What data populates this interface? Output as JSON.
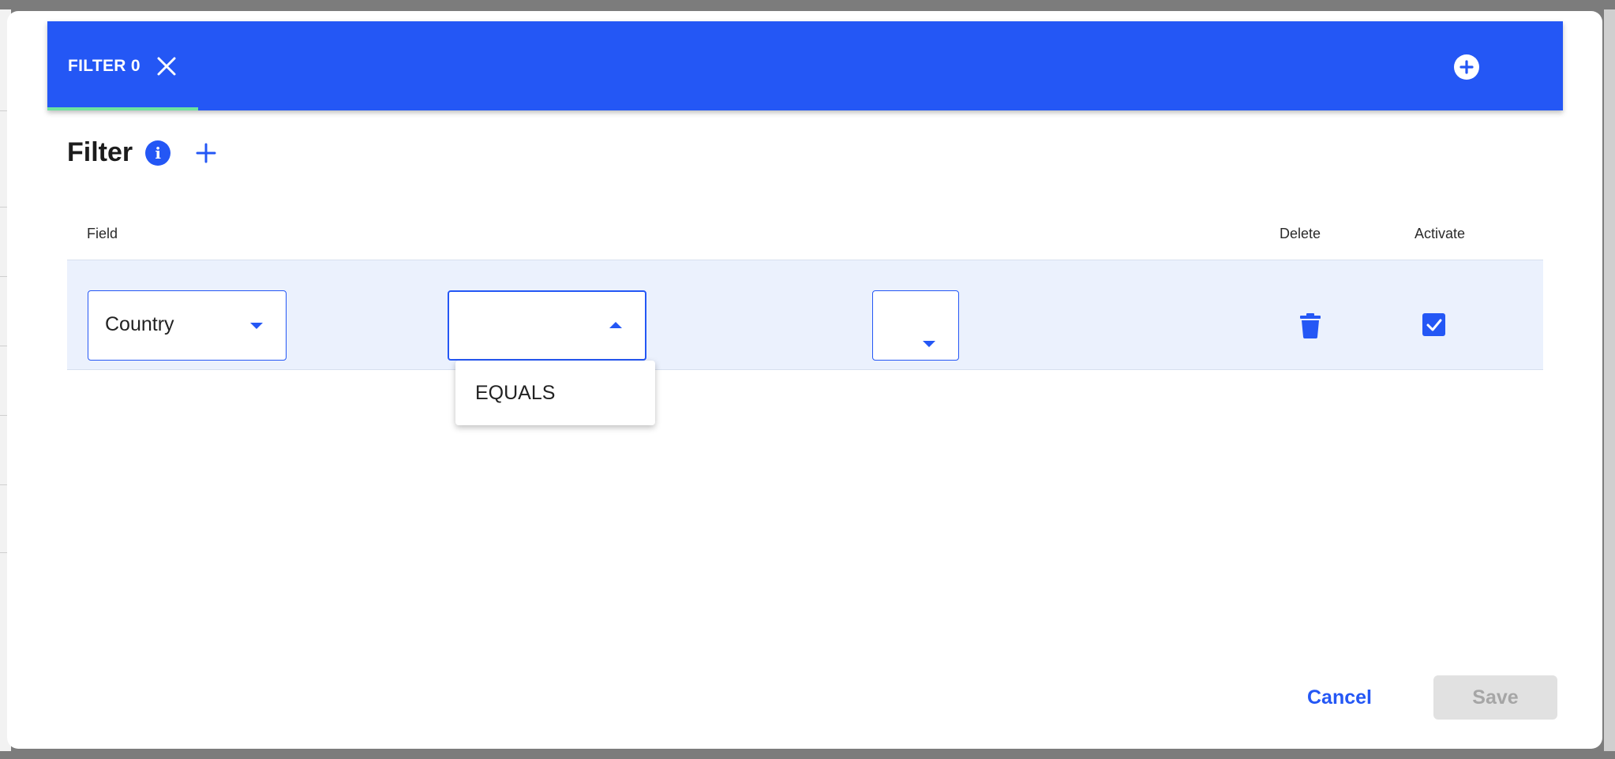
{
  "tabs": [
    {
      "label": "FILTER 0",
      "active": true
    }
  ],
  "filter": {
    "heading": "Filter",
    "info_glyph": "i",
    "columns": {
      "field": "Field",
      "delete": "Delete",
      "activate": "Activate"
    },
    "rows": [
      {
        "field_value": "Country",
        "operator_value": "",
        "value_value": "",
        "activated": true
      }
    ],
    "operator_options": [
      "EQUALS"
    ]
  },
  "footer": {
    "cancel_label": "Cancel",
    "save_label": "Save",
    "save_enabled": false
  },
  "colors": {
    "accent": "#2457f5",
    "tab_indicator": "#6de3a0",
    "row_background": "#ebf1fd",
    "disabled_background": "#e1e1e1",
    "disabled_text": "#a6a6a6"
  },
  "icons": [
    "close-icon",
    "add-circle-icon",
    "info-icon",
    "plus-icon",
    "chevron-down-icon",
    "chevron-up-icon",
    "trash-icon",
    "checkbox-checked-icon"
  ]
}
